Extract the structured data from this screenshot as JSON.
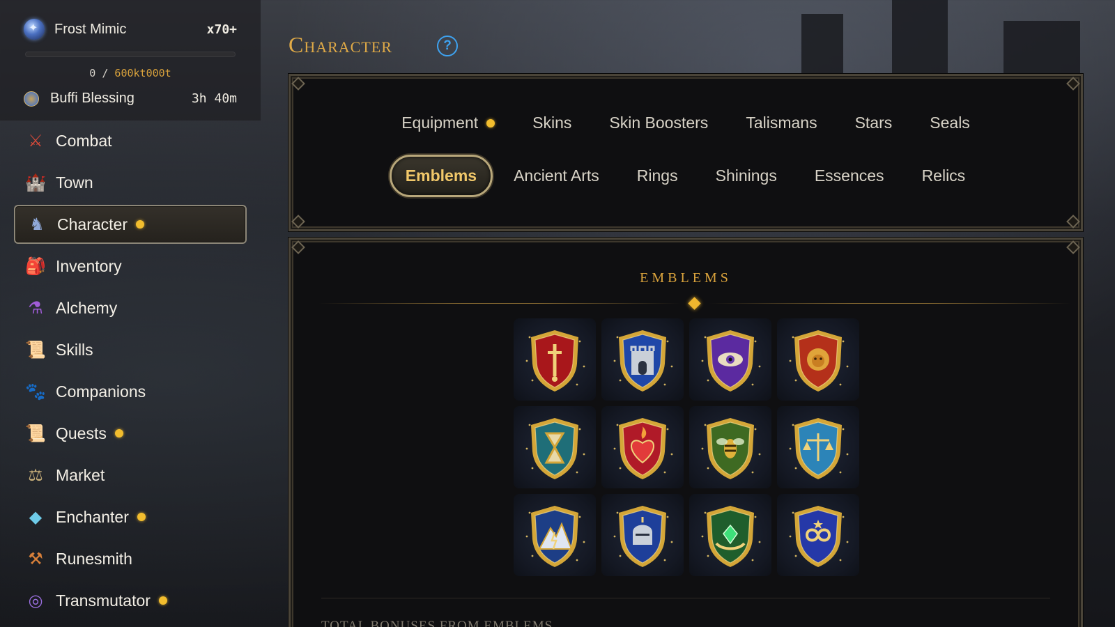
{
  "player": {
    "name": "Frost Mimic",
    "multiplier": "x70+",
    "xp_current": "0",
    "xp_separator": "/",
    "xp_goal": "600kt000t",
    "xp_progress_fraction": 0
  },
  "buff": {
    "label": "Buffi Blessing",
    "time_left": "3h 40m"
  },
  "nav": {
    "items": [
      {
        "label": "Combat",
        "icon": "crossed-swords-icon",
        "notify": false,
        "active": false
      },
      {
        "label": "Town",
        "icon": "castle-icon",
        "notify": false,
        "active": false
      },
      {
        "label": "Character",
        "icon": "knight-icon",
        "notify": true,
        "active": true
      },
      {
        "label": "Inventory",
        "icon": "backpack-icon",
        "notify": false,
        "active": false
      },
      {
        "label": "Alchemy",
        "icon": "potion-icon",
        "notify": false,
        "active": false
      },
      {
        "label": "Skills",
        "icon": "scroll-icon",
        "notify": false,
        "active": false
      },
      {
        "label": "Companions",
        "icon": "paw-icon",
        "notify": false,
        "active": false
      },
      {
        "label": "Quests",
        "icon": "quest-scroll-icon",
        "notify": true,
        "active": false
      },
      {
        "label": "Market",
        "icon": "scales-icon",
        "notify": false,
        "active": false
      },
      {
        "label": "Enchanter",
        "icon": "crystal-icon",
        "notify": true,
        "active": false
      },
      {
        "label": "Runesmith",
        "icon": "hammer-icon",
        "notify": false,
        "active": false
      },
      {
        "label": "Transmutator",
        "icon": "swirl-orb-icon",
        "notify": true,
        "active": false
      }
    ]
  },
  "page": {
    "title": "Character",
    "help_icon": "question-mark-icon"
  },
  "tabs": {
    "row1": [
      {
        "label": "Equipment",
        "notify": true
      },
      {
        "label": "Skins",
        "notify": false
      },
      {
        "label": "Skin Boosters",
        "notify": false
      },
      {
        "label": "Talismans",
        "notify": false
      },
      {
        "label": "Stars",
        "notify": false
      },
      {
        "label": "Seals",
        "notify": false
      }
    ],
    "row2": [
      {
        "label": "Emblems",
        "notify": false,
        "active": true
      },
      {
        "label": "Ancient Arts",
        "notify": false
      },
      {
        "label": "Rings",
        "notify": false
      },
      {
        "label": "Shinings",
        "notify": false
      },
      {
        "label": "Essences",
        "notify": false
      },
      {
        "label": "Relics",
        "notify": false
      }
    ]
  },
  "emblems": {
    "title": "EMBLEMS",
    "items": [
      {
        "icon": "sword-shield-emblem-icon",
        "fill": "#a8171b"
      },
      {
        "icon": "castle-gate-emblem-icon",
        "fill": "#1f47a8"
      },
      {
        "icon": "eye-emblem-icon",
        "fill": "#5b2aa0"
      },
      {
        "icon": "lion-emblem-icon",
        "fill": "#b4301a"
      },
      {
        "icon": "hourglass-emblem-icon",
        "fill": "#1f6e78"
      },
      {
        "icon": "flaming-heart-emblem-icon",
        "fill": "#b01a28"
      },
      {
        "icon": "bee-emblem-icon",
        "fill": "#3e6a22"
      },
      {
        "icon": "scales-emblem-icon",
        "fill": "#2c84b8"
      },
      {
        "icon": "mountain-emblem-icon",
        "fill": "#1d3e86"
      },
      {
        "icon": "helmet-emblem-icon",
        "fill": "#1e3f9a"
      },
      {
        "icon": "gem-hands-emblem-icon",
        "fill": "#1f5e2c"
      },
      {
        "icon": "infinity-emblem-icon",
        "fill": "#2538a8"
      }
    ]
  },
  "bonuses": {
    "title": "TOTAL BONUSES FROM EMBLEMS"
  },
  "colors": {
    "accent_gold": "#d9a23c",
    "notify_dot": "#f2bd2e",
    "help_blue": "#3ea2f0",
    "emblem_frame_gold": "#d4a638"
  }
}
